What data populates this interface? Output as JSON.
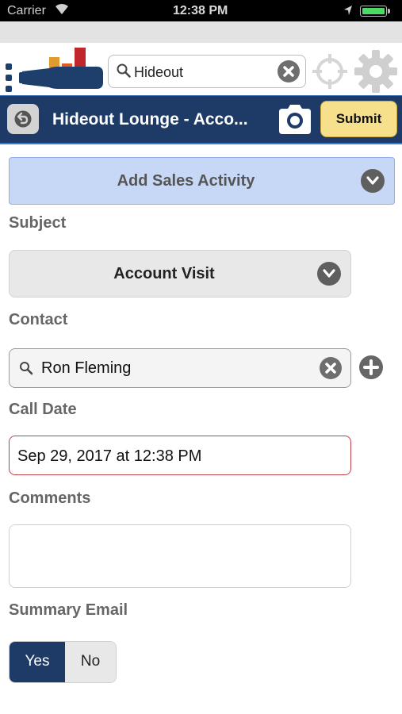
{
  "status_bar": {
    "carrier": "Carrier",
    "time": "12:38 PM"
  },
  "search": {
    "value": "Hideout"
  },
  "navbar": {
    "title": "Hideout Lounge - Acco...",
    "submit_label": "Submit"
  },
  "form": {
    "section_header": "Add Sales Activity",
    "subject_label": "Subject",
    "subject_value": "Account Visit",
    "contact_label": "Contact",
    "contact_value": "Ron Fleming",
    "call_date_label": "Call Date",
    "call_date_value": "Sep 29, 2017 at 12:38 PM",
    "comments_label": "Comments",
    "comments_value": "",
    "summary_email_label": "Summary Email",
    "summary_email_options": [
      "Yes",
      "No"
    ],
    "summary_email_selected": "Yes"
  },
  "colors": {
    "navbar": "#1e3a66",
    "submit": "#f7e08c",
    "section_header": "#c7d8f6",
    "toggle_selected": "#1e3a66",
    "date_border": "#c0404a"
  },
  "icons": [
    "wifi-icon",
    "location-arrow-icon",
    "battery-icon",
    "menu-dots-icon",
    "wine-logo",
    "search-icon",
    "clear-icon",
    "crosshair-icon",
    "gear-icon",
    "back-icon",
    "camera-icon",
    "chevron-down-icon",
    "add-icon"
  ]
}
